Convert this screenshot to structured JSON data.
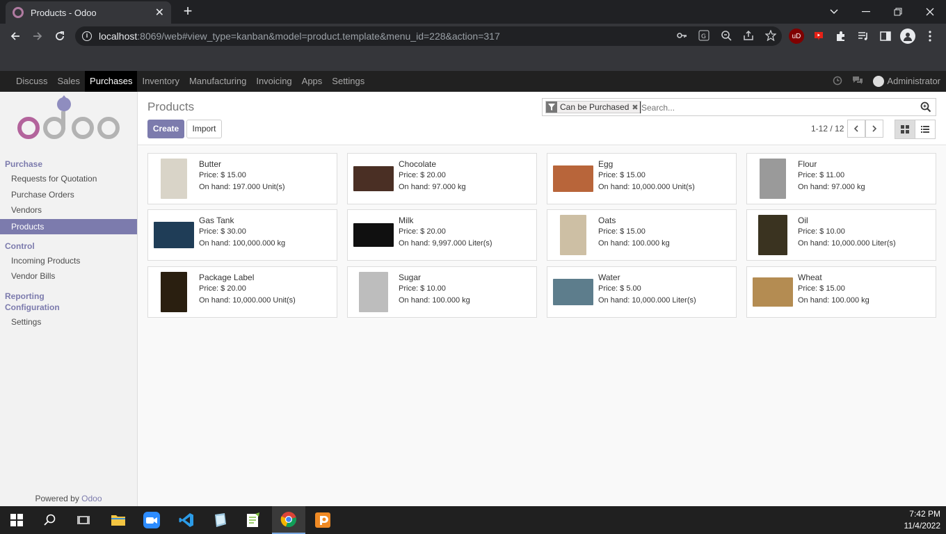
{
  "browser": {
    "tab_title": "Products - Odoo",
    "tab_close": "✕",
    "new_tab": "+",
    "url_host": "localhost",
    "url_rest": ":8069/web#view_type=kanban&model=product.template&menu_id=228&action=317"
  },
  "topnav": {
    "items": [
      "Discuss",
      "Sales",
      "Purchases",
      "Inventory",
      "Manufacturing",
      "Invoicing",
      "Apps",
      "Settings"
    ],
    "active": "Purchases",
    "user": "Administrator"
  },
  "sidebar": {
    "sections": [
      {
        "title": "Purchase",
        "items": [
          "Requests for Quotation",
          "Purchase Orders",
          "Vendors",
          "Products"
        ]
      },
      {
        "title": "Control",
        "items": [
          "Incoming Products",
          "Vendor Bills"
        ]
      },
      {
        "title": "Reporting",
        "items": []
      },
      {
        "title": "Configuration",
        "items": [
          "Settings"
        ]
      }
    ],
    "active_item": "Products",
    "powered_by": "Powered by",
    "powered_brand": "Odoo"
  },
  "control_panel": {
    "breadcrumb": "Products",
    "create_label": "Create",
    "import_label": "Import",
    "facet_label": "Can be Purchased",
    "search_placeholder": "Search...",
    "pager": "1-12 / 12",
    "view": "kanban"
  },
  "products": [
    {
      "name": "Butter",
      "price": "Price: $ 15.00",
      "on_hand": "On hand: 197.000 Unit(s)",
      "img_color": "#d9d4c8"
    },
    {
      "name": "Chocolate",
      "price": "Price: $ 20.00",
      "on_hand": "On hand: 97.000 kg",
      "img_color": "#4a2f24"
    },
    {
      "name": "Egg",
      "price": "Price: $ 15.00",
      "on_hand": "On hand: 10,000.000 Unit(s)",
      "img_color": "#b8653a"
    },
    {
      "name": "Flour",
      "price": "Price: $ 11.00",
      "on_hand": "On hand: 97.000 kg",
      "img_color": "#9a9a9a"
    },
    {
      "name": "Gas Tank",
      "price": "Price: $ 30.00",
      "on_hand": "On hand: 100,000.000 kg",
      "img_color": "#1f3d57"
    },
    {
      "name": "Milk",
      "price": "Price: $ 20.00",
      "on_hand": "On hand: 9,997.000 Liter(s)",
      "img_color": "#101010"
    },
    {
      "name": "Oats",
      "price": "Price: $ 15.00",
      "on_hand": "On hand: 100.000 kg",
      "img_color": "#cdbfa4"
    },
    {
      "name": "Oil",
      "price": "Price: $ 10.00",
      "on_hand": "On hand: 10,000.000 Liter(s)",
      "img_color": "#3a3320"
    },
    {
      "name": "Package Label",
      "price": "Price: $ 20.00",
      "on_hand": "On hand: 10,000.000 Unit(s)",
      "img_color": "#2a1f10"
    },
    {
      "name": "Sugar",
      "price": "Price: $ 10.00",
      "on_hand": "On hand: 100.000 kg",
      "img_color": "#bdbdbd"
    },
    {
      "name": "Water",
      "price": "Price: $ 5.00",
      "on_hand": "On hand: 10,000.000 Liter(s)",
      "img_color": "#5d7d8c"
    },
    {
      "name": "Wheat",
      "price": "Price: $ 15.00",
      "on_hand": "On hand: 100.000 kg",
      "img_color": "#b48c52"
    }
  ],
  "taskbar": {
    "time": "7:42 PM",
    "date": "11/4/2022"
  },
  "colors": {
    "accent": "#7c7bad",
    "navbar": "#212121"
  }
}
